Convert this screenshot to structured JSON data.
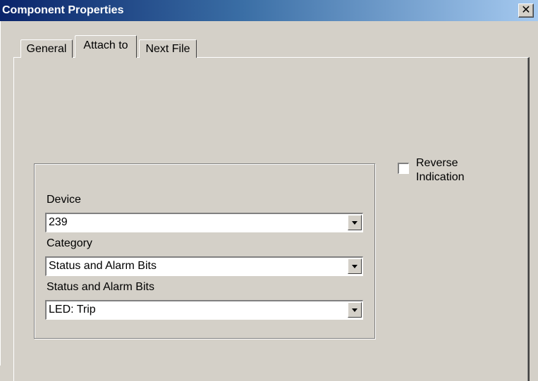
{
  "window": {
    "title": "Component Properties",
    "close_label": "✕"
  },
  "tabs": [
    {
      "label": "General",
      "active": false
    },
    {
      "label": "Attach to",
      "active": true
    },
    {
      "label": "Next File",
      "active": false
    }
  ],
  "form": {
    "device": {
      "label": "Device",
      "value": "239"
    },
    "category": {
      "label": "Category",
      "value": "Status and Alarm Bits"
    },
    "status": {
      "label": "Status and Alarm Bits",
      "value": "LED: Trip"
    }
  },
  "reverse": {
    "line1": "Reverse",
    "line2": "Indication",
    "checked": false
  }
}
